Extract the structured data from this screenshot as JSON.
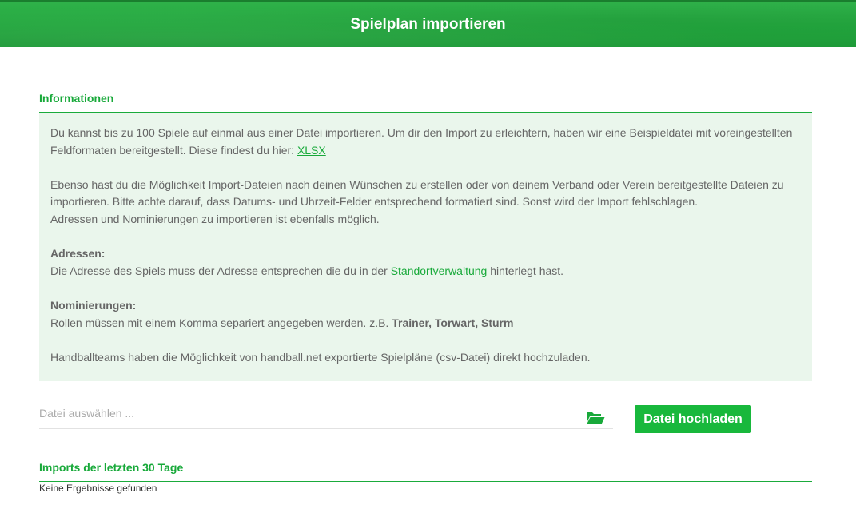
{
  "header": {
    "title": "Spielplan importieren"
  },
  "info": {
    "heading": "Informationen",
    "p1_text": "Du kannst bis zu 100 Spiele auf einmal aus einer Datei importieren. Um dir den Import zu erleichtern, haben wir eine Beispieldatei mit voreingestellten Feldformaten bereitgestellt. Diese findest du hier: ",
    "p1_link": "XLSX",
    "p2_line1": "Ebenso hast du die Möglichkeit Import-Dateien nach deinen Wünschen zu erstellen oder von deinem Verband oder Verein bereitgestellte Dateien zu importieren. Bitte achte darauf, dass Datums- und Uhrzeit-Felder entsprechend formatiert sind. Sonst wird der Import fehlschlagen.",
    "p2_line2": "Adressen und Nominierungen zu importieren ist ebenfalls möglich.",
    "addresses_label": "Adressen:",
    "addresses_text_before": "Die Adresse des Spiels muss der Adresse entsprechen die du in der ",
    "addresses_link": "Standortverwaltung",
    "addresses_text_after": " hinterlegt hast.",
    "nominations_label": "Nominierungen:",
    "nominations_text": "Rollen müssen mit einem Komma separiert angegeben werden. z.B. ",
    "nominations_example": "Trainer, Torwart, Sturm",
    "handball_text": "Handballteams haben die Möglichkeit von handball.net exportierte Spielpläne (csv-Datei) direkt hochzuladen."
  },
  "upload": {
    "placeholder": "Datei auswählen ...",
    "folder_icon": "folder-open-icon",
    "button_label": "Datei hochladen"
  },
  "imports": {
    "heading": "Imports der letzten 30 Tage",
    "empty_text": "Keine Ergebnisse gefunden"
  },
  "colors": {
    "brand_green": "#18a93a",
    "info_background": "#eaf6ec",
    "button_green": "#18b83c"
  }
}
